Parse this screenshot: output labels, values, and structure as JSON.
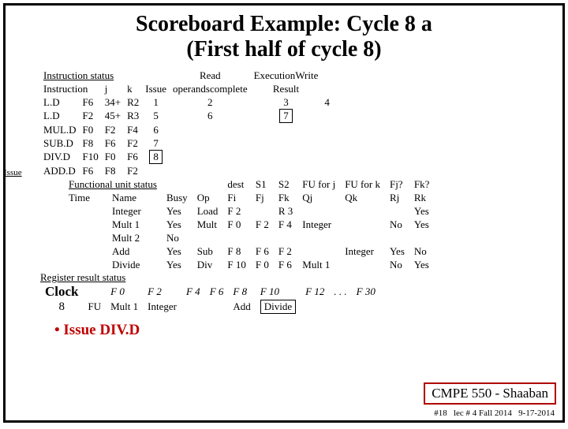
{
  "title_line1": "Scoreboard Example:  Cycle 8 a",
  "title_line2": "(First half of cycle 8)",
  "issue_side_label": "Issue",
  "instr_status": {
    "header": "Instruction status",
    "cols": {
      "instr": "Instruction",
      "j": "j",
      "k": "k",
      "issue": "Issue",
      "read": "Read",
      "exec": "Execution",
      "write": "Write",
      "operands": "operands",
      "complete": "complete",
      "result": "Result"
    },
    "rows": [
      {
        "op": "L.D",
        "dest": "F6",
        "j": "34+",
        "k": "R2",
        "issue": "1",
        "read": "2",
        "exec": "3",
        "write": "4",
        "box_issue": false,
        "box_exec": false
      },
      {
        "op": "L.D",
        "dest": "F2",
        "j": "45+",
        "k": "R3",
        "issue": "5",
        "read": "6",
        "exec": "7",
        "write": "",
        "box_issue": false,
        "box_exec": true
      },
      {
        "op": "MUL.D",
        "dest": "F0",
        "j": "F2",
        "k": "F4",
        "issue": "6",
        "read": "",
        "exec": "",
        "write": "",
        "box_issue": false,
        "box_exec": false
      },
      {
        "op": "SUB.D",
        "dest": "F8",
        "j": "F6",
        "k": "F2",
        "issue": "7",
        "read": "",
        "exec": "",
        "write": "",
        "box_issue": false,
        "box_exec": false
      },
      {
        "op": "DIV.D",
        "dest": "F10",
        "j": "F0",
        "k": "F6",
        "issue": "8",
        "read": "",
        "exec": "",
        "write": "",
        "box_issue": true,
        "box_exec": false
      },
      {
        "op": "ADD.D",
        "dest": "F6",
        "j": "F8",
        "k": "F2",
        "issue": "",
        "read": "",
        "exec": "",
        "write": "",
        "box_issue": false,
        "box_exec": false
      }
    ]
  },
  "fu_status": {
    "header": "Functional unit status",
    "cols": {
      "time": "Time",
      "name": "Name",
      "busy": "Busy",
      "op": "Op",
      "dest": "dest",
      "fi": "Fi",
      "s1": "S1",
      "fj": "Fj",
      "s2": "S2",
      "fk": "Fk",
      "fuj": "FU for j",
      "qj": "Qj",
      "fuk": "FU for k",
      "qk": "Qk",
      "fjq": "Fj?",
      "rj": "Rj",
      "fkq": "Fk?",
      "rk": "Rk"
    },
    "rows": [
      {
        "name": "Integer",
        "busy": "Yes",
        "op": "Load",
        "fi": "F 2",
        "fj": "",
        "fk": "R 3",
        "qj": "",
        "qk": "",
        "rj": "",
        "rk": "Yes"
      },
      {
        "name": "Mult 1",
        "busy": "Yes",
        "op": "Mult",
        "fi": "F 0",
        "fj": "F 2",
        "fk": "F 4",
        "qj": "Integer",
        "qk": "",
        "rj": "No",
        "rk": "Yes"
      },
      {
        "name": "Mult 2",
        "busy": "No",
        "op": "",
        "fi": "",
        "fj": "",
        "fk": "",
        "qj": "",
        "qk": "",
        "rj": "",
        "rk": ""
      },
      {
        "name": "Add",
        "busy": "Yes",
        "op": "Sub",
        "fi": "F 8",
        "fj": "F 6",
        "fk": "F 2",
        "qj": "",
        "qk": "Integer",
        "rj": "Yes",
        "rk": "No"
      },
      {
        "name": "Divide",
        "busy": "Yes",
        "op": "Div",
        "fi": "F 10",
        "fj": "F 0",
        "fk": "F 6",
        "qj": "Mult 1",
        "qk": "",
        "rj": "No",
        "rk": "Yes"
      }
    ]
  },
  "reg_status": {
    "header": "Register result status",
    "clock_label": "Clock",
    "clock_val": "8",
    "fu_label": "FU",
    "regs": [
      "F 0",
      "F 2",
      "F 4",
      "F 6",
      "F 8",
      "F 10",
      "F 12",
      ". . .",
      "F 30"
    ],
    "vals": [
      "Mult 1",
      "Integer",
      "",
      "",
      "Add",
      "Divide",
      "",
      "",
      ""
    ],
    "box_idx": 5
  },
  "issue_note_bullet": "•",
  "issue_note": "Issue DIV.D",
  "source": "CMPE 550 - Shaaban",
  "footer_slide": "#18",
  "footer_lec": "lec # 4 Fall 2014",
  "footer_date": "9-17-2014"
}
